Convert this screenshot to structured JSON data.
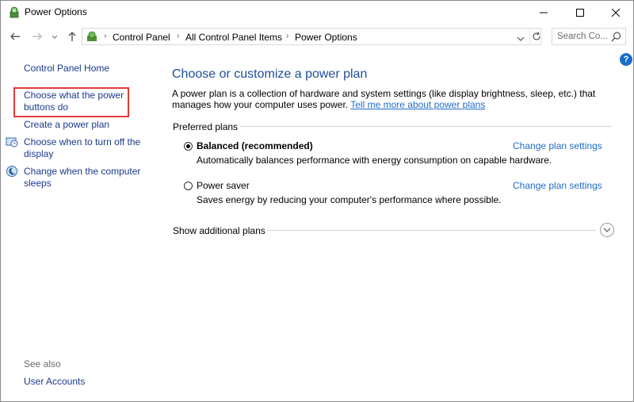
{
  "window": {
    "title": "Power Options"
  },
  "address_bar": {
    "breadcrumbs": [
      "Control Panel",
      "All Control Panel Items",
      "Power Options"
    ]
  },
  "search": {
    "placeholder": "Search Co..."
  },
  "sidebar": {
    "home": "Control Panel Home",
    "links": [
      {
        "label_line1": "Choose what the power",
        "label_line2": "buttons do"
      },
      {
        "label_line1": "Create a power plan"
      },
      {
        "label_line1": "Choose when to turn off the",
        "label_line2": "display"
      },
      {
        "label_line1": "Change when the computer",
        "label_line2": "sleeps"
      }
    ],
    "see_also": "See also",
    "user_accounts": "User Accounts"
  },
  "main": {
    "heading": "Choose or customize a power plan",
    "description": "A power plan is a collection of hardware and system settings (like display brightness, sleep, etc.) that manages how your computer uses power.",
    "tell_me_more": "Tell me more about power plans",
    "preferred_plans_label": "Preferred plans",
    "plans": [
      {
        "name": "Balanced (recommended)",
        "selected": true,
        "description": "Automatically balances performance with energy consumption on capable hardware.",
        "settings_link": "Change plan settings"
      },
      {
        "name": "Power saver",
        "selected": false,
        "description": "Saves energy by reducing your computer's performance where possible.",
        "settings_link": "Change plan settings"
      }
    ],
    "show_additional": "Show additional plans"
  },
  "colors": {
    "highlight_border": "#e13a3a",
    "link": "#1f6bc8",
    "heading": "#1f4e9a"
  }
}
